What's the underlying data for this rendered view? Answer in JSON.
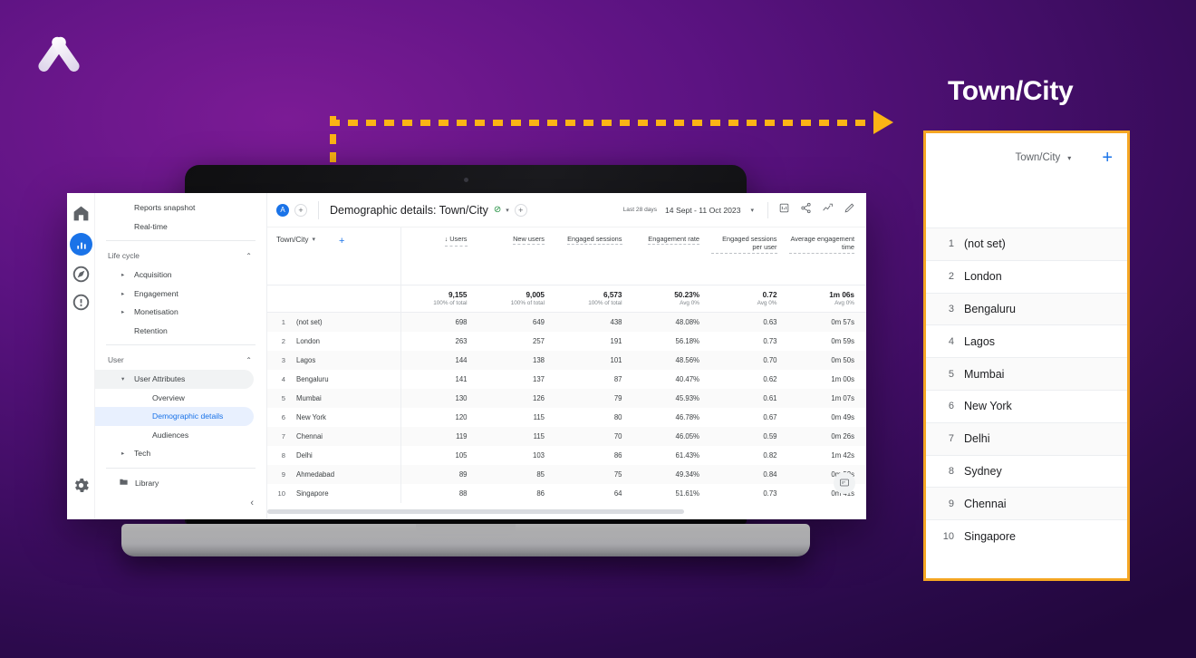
{
  "brand": {
    "logo_name": "x-logo"
  },
  "annotation": {
    "arrow_name": "dashed-arrow-annotation",
    "color": "#fcb415"
  },
  "panel": {
    "title": "Town/City",
    "dimension_label": "Town/City",
    "add_label": "+",
    "border_color": "#f5a623",
    "rows": [
      {
        "index": "1",
        "name": "(not set)"
      },
      {
        "index": "2",
        "name": "London"
      },
      {
        "index": "3",
        "name": "Bengaluru"
      },
      {
        "index": "4",
        "name": "Lagos"
      },
      {
        "index": "5",
        "name": "Mumbai"
      },
      {
        "index": "6",
        "name": "New York"
      },
      {
        "index": "7",
        "name": "Delhi"
      },
      {
        "index": "8",
        "name": "Sydney"
      },
      {
        "index": "9",
        "name": "Chennai"
      },
      {
        "index": "10",
        "name": "Singapore"
      }
    ]
  },
  "app": {
    "account_initial": "A",
    "add_comparison_label": "+",
    "title": "Demographic details: Town/City",
    "title_status_icon": "check-circle-icon",
    "title_caret": "▾",
    "title_add_label": "+",
    "date_prefix": "Last 28 days",
    "date_range": "14 Sept - 11 Oct 2023",
    "date_caret": "▾",
    "header_icons": [
      "insights-icon",
      "share-icon",
      "trend-icon",
      "edit-icon"
    ],
    "feedback_icon": "feedback-icon"
  },
  "rail": {
    "icons": [
      "home-icon",
      "reports-icon",
      "explore-icon",
      "advertising-icon",
      "gear-icon"
    ],
    "active": "reports-icon",
    "active_color": "#1a73e8"
  },
  "nav": {
    "items": [
      {
        "label": "Reports snapshot",
        "type": "item"
      },
      {
        "label": "Real-time",
        "type": "item"
      },
      {
        "label": "Life cycle",
        "type": "section"
      },
      {
        "label": "Acquisition",
        "type": "expandable"
      },
      {
        "label": "Engagement",
        "type": "expandable"
      },
      {
        "label": "Monetisation",
        "type": "expandable"
      },
      {
        "label": "Retention",
        "type": "item"
      },
      {
        "label": "User",
        "type": "section"
      },
      {
        "label": "User Attributes",
        "type": "group"
      },
      {
        "label": "Overview",
        "type": "sub"
      },
      {
        "label": "Demographic details",
        "type": "sub-active"
      },
      {
        "label": "Audiences",
        "type": "sub"
      },
      {
        "label": "Tech",
        "type": "expandable"
      }
    ],
    "library_label": "Library",
    "collapse_label": "‹"
  },
  "table": {
    "dimension_label": "Town/City",
    "dimension_caret": "▾",
    "add_dimension_label": "+",
    "columns": [
      {
        "label": "Users",
        "sorted": true,
        "sort_glyph": "↓"
      },
      {
        "label": "New users",
        "sorted": false
      },
      {
        "label": "Engaged sessions",
        "sorted": false
      },
      {
        "label": "Engagement rate",
        "sorted": false
      },
      {
        "label": "Engaged sessions per user",
        "sorted": false
      },
      {
        "label": "Average engagement time",
        "sorted": false
      }
    ],
    "summary": [
      {
        "value": "9,155",
        "sub": "100% of total"
      },
      {
        "value": "9,005",
        "sub": "100% of total"
      },
      {
        "value": "6,573",
        "sub": "100% of total"
      },
      {
        "value": "50.23%",
        "sub": "Avg 0%"
      },
      {
        "value": "0.72",
        "sub": "Avg 0%"
      },
      {
        "value": "1m 06s",
        "sub": "Avg 0%"
      }
    ],
    "rows": [
      {
        "index": "1",
        "name": "(not set)",
        "users": "698",
        "new_users": "649",
        "engaged_sessions": "438",
        "engagement_rate": "48.08%",
        "sessions_per_user": "0.63",
        "avg_time": "0m 57s"
      },
      {
        "index": "2",
        "name": "London",
        "users": "263",
        "new_users": "257",
        "engaged_sessions": "191",
        "engagement_rate": "56.18%",
        "sessions_per_user": "0.73",
        "avg_time": "0m 59s"
      },
      {
        "index": "3",
        "name": "Lagos",
        "users": "144",
        "new_users": "138",
        "engaged_sessions": "101",
        "engagement_rate": "48.56%",
        "sessions_per_user": "0.70",
        "avg_time": "0m 50s"
      },
      {
        "index": "4",
        "name": "Bengaluru",
        "users": "141",
        "new_users": "137",
        "engaged_sessions": "87",
        "engagement_rate": "40.47%",
        "sessions_per_user": "0.62",
        "avg_time": "1m 00s"
      },
      {
        "index": "5",
        "name": "Mumbai",
        "users": "130",
        "new_users": "126",
        "engaged_sessions": "79",
        "engagement_rate": "45.93%",
        "sessions_per_user": "0.61",
        "avg_time": "1m 07s"
      },
      {
        "index": "6",
        "name": "New York",
        "users": "120",
        "new_users": "115",
        "engaged_sessions": "80",
        "engagement_rate": "46.78%",
        "sessions_per_user": "0.67",
        "avg_time": "0m 49s"
      },
      {
        "index": "7",
        "name": "Chennai",
        "users": "119",
        "new_users": "115",
        "engaged_sessions": "70",
        "engagement_rate": "46.05%",
        "sessions_per_user": "0.59",
        "avg_time": "0m 26s"
      },
      {
        "index": "8",
        "name": "Delhi",
        "users": "105",
        "new_users": "103",
        "engaged_sessions": "86",
        "engagement_rate": "61.43%",
        "sessions_per_user": "0.82",
        "avg_time": "1m 42s"
      },
      {
        "index": "9",
        "name": "Ahmedabad",
        "users": "89",
        "new_users": "85",
        "engaged_sessions": "75",
        "engagement_rate": "49.34%",
        "sessions_per_user": "0.84",
        "avg_time": "0m 52s"
      },
      {
        "index": "10",
        "name": "Singapore",
        "users": "88",
        "new_users": "86",
        "engaged_sessions": "64",
        "engagement_rate": "51.61%",
        "sessions_per_user": "0.73",
        "avg_time": "0m 41s"
      }
    ]
  }
}
